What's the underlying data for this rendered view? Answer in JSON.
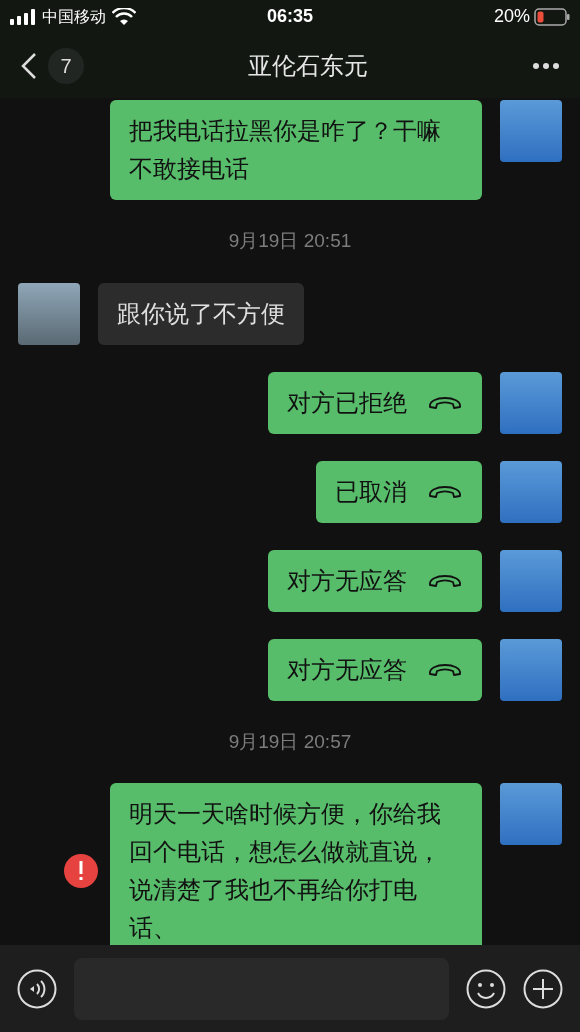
{
  "status_bar": {
    "carrier": "中国移动",
    "time": "06:35",
    "battery": "20%"
  },
  "nav": {
    "back_count": "7",
    "title": "亚伦石东元"
  },
  "messages": [
    {
      "kind": "sent_text",
      "text": "把我电话拉黑你是咋了？干嘛不敢接电话",
      "failed": false
    },
    {
      "kind": "time",
      "text": "9月19日 20:51"
    },
    {
      "kind": "received_text",
      "text": "跟你说了不方便",
      "failed": false
    },
    {
      "kind": "sent_call",
      "text": "对方已拒绝",
      "failed": false
    },
    {
      "kind": "sent_call",
      "text": "已取消",
      "failed": false
    },
    {
      "kind": "sent_call",
      "text": "对方无应答",
      "failed": false
    },
    {
      "kind": "sent_call",
      "text": "对方无应答",
      "failed": false
    },
    {
      "kind": "time",
      "text": "9月19日 20:57"
    },
    {
      "kind": "sent_text",
      "text": "明天一天啥时候方便，你给我回个电话，想怎么做就直说，说清楚了我也不再给你打电话、",
      "failed": true
    }
  ]
}
